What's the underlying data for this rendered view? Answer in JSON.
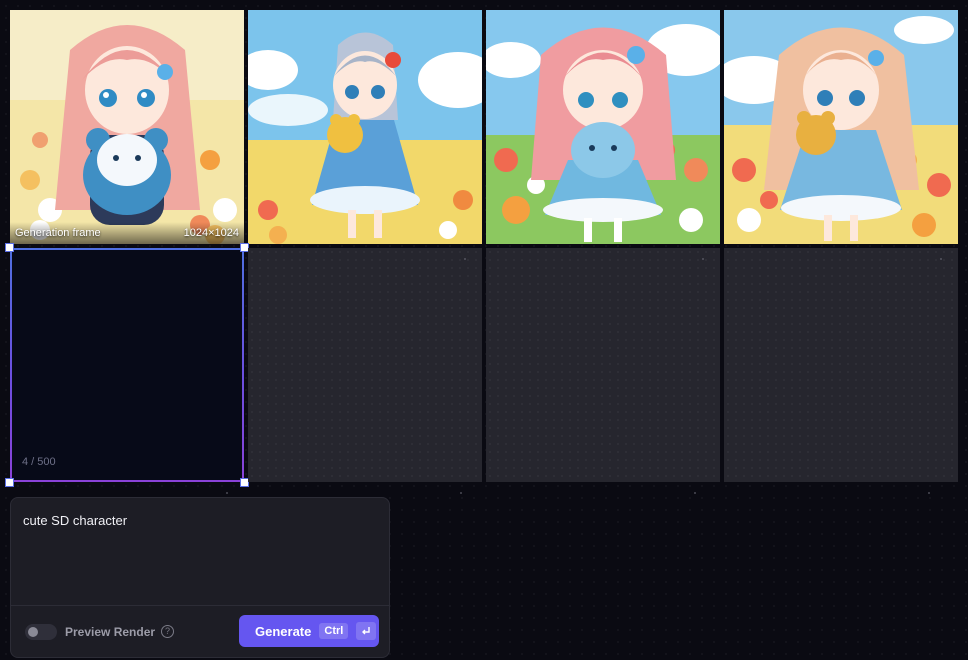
{
  "generation_frame": {
    "label": "Generation frame",
    "size": "1024×1024",
    "char_count": "4 / 500"
  },
  "images": [
    {
      "name": "anime-girl-blue-bear",
      "hair": "#f0a8a0",
      "outfit": "#3a8ab8",
      "toy": "#3f8fc4"
    },
    {
      "name": "anime-girl-yellow-bear",
      "hair": "#b8c4d8",
      "outfit": "#5aa0d8",
      "toy": "#f0c040"
    },
    {
      "name": "anime-girl-blue-plush",
      "hair": "#f09ca0",
      "outfit": "#70b8e0",
      "toy": "#8cc8e8"
    },
    {
      "name": "anime-girl-teddy-bear",
      "hair": "#f0c0a0",
      "outfit": "#78b8e0",
      "toy": "#e8b040"
    }
  ],
  "prompt": {
    "text": "cute SD character"
  },
  "controls": {
    "preview_label": "Preview Render",
    "preview_enabled": false,
    "help_icon": "?",
    "generate_label": "Generate",
    "shortcut_modifier": "Ctrl",
    "shortcut_key_icon": "enter-icon"
  },
  "colors": {
    "accent": "#6556f0",
    "frame_gradient_start": "#4f6fe0",
    "frame_gradient_end": "#8a42d8"
  }
}
